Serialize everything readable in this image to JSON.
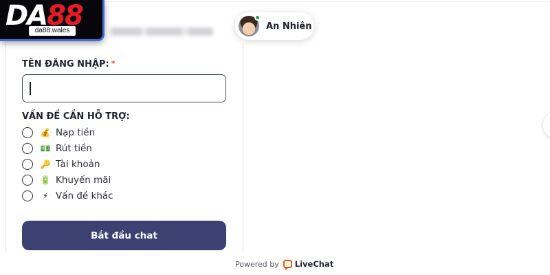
{
  "brand": {
    "logo_primary": "DA",
    "logo_accent": "88",
    "logo_domain": "da88.wales",
    "accent_color": "#e41d24",
    "border_color": "#3a6fd8"
  },
  "agent": {
    "name": "An Nhiên",
    "status_color": "#23a55a"
  },
  "form": {
    "username_label": "TÊN ĐĂNG NHẬP:",
    "required_mark": "*",
    "username_value": "",
    "issue_label": "VẤN ĐỀ CẦN HỖ TRỢ:",
    "options": [
      {
        "emoji": "💰",
        "label": "Nạp tiền"
      },
      {
        "emoji": "💵",
        "label": "Rút tiền"
      },
      {
        "emoji": "🔑",
        "label": "Tài khoản"
      },
      {
        "emoji": "🔋",
        "label": "Khuyến mãi"
      },
      {
        "emoji": "⚡",
        "label": "Vấn đề khác"
      }
    ],
    "submit_label": "Bắt đầu chat",
    "button_color": "#3b4272"
  },
  "footer": {
    "powered_by": "Powered by",
    "brand": "LiveChat",
    "brand_color": "#ff5100"
  }
}
